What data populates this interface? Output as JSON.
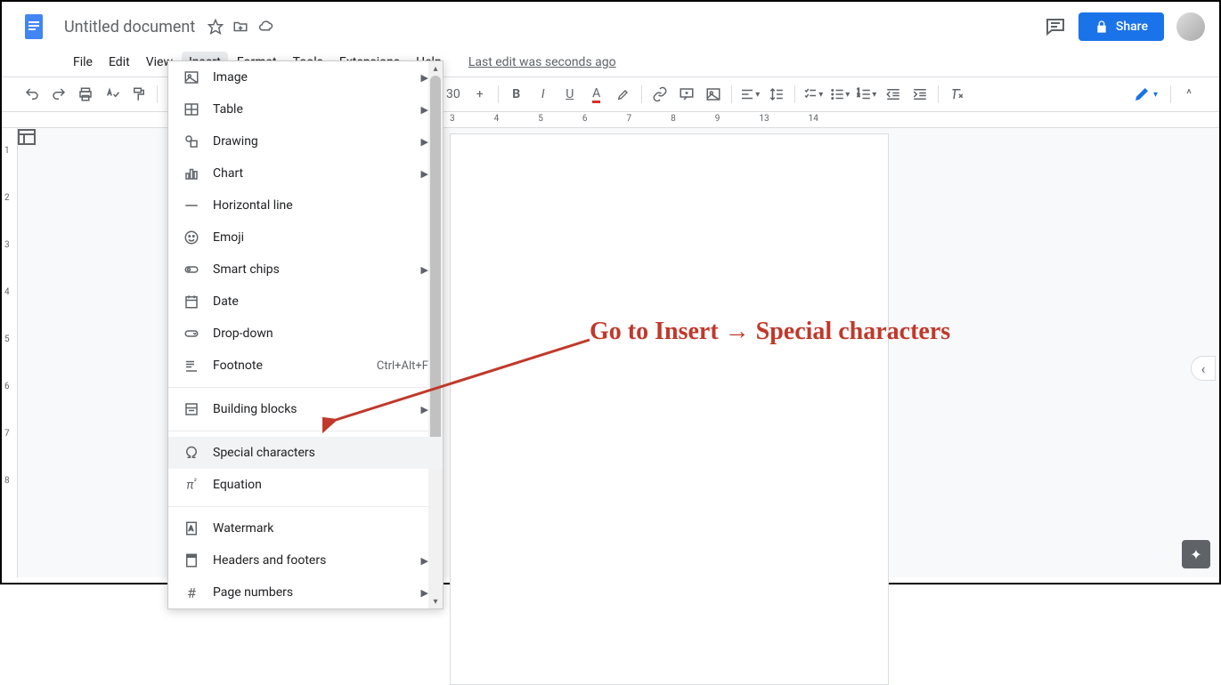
{
  "header": {
    "doc_title": "Untitled document",
    "share_label": "Share",
    "last_edit": "Last edit was seconds ago"
  },
  "menubar": {
    "items": [
      "File",
      "Edit",
      "View",
      "Insert",
      "Format",
      "Tools",
      "Extensions",
      "Help"
    ],
    "active_index": 3
  },
  "toolbar": {
    "zoom_visible": "30",
    "ruler_numbers": [
      "3",
      "4",
      "5",
      "6",
      "7",
      "8",
      "9",
      "13",
      "14"
    ],
    "ruler_v": [
      "1",
      "2",
      "3",
      "4",
      "5",
      "6",
      "7",
      "8"
    ]
  },
  "dropdown": {
    "groups": [
      [
        {
          "icon": "image",
          "label": "Image",
          "submenu": true
        },
        {
          "icon": "table",
          "label": "Table",
          "submenu": true
        },
        {
          "icon": "drawing",
          "label": "Drawing",
          "submenu": true
        },
        {
          "icon": "chart",
          "label": "Chart",
          "submenu": true
        },
        {
          "icon": "hr",
          "label": "Horizontal line"
        },
        {
          "icon": "emoji",
          "label": "Emoji"
        },
        {
          "icon": "chip",
          "label": "Smart chips",
          "submenu": true
        },
        {
          "icon": "date",
          "label": "Date"
        },
        {
          "icon": "dropdown",
          "label": "Drop-down"
        },
        {
          "icon": "footnote",
          "label": "Footnote",
          "shortcut": "Ctrl+Alt+F"
        }
      ],
      [
        {
          "icon": "blocks",
          "label": "Building blocks",
          "submenu": true
        }
      ],
      [
        {
          "icon": "omega",
          "label": "Special characters",
          "highlighted": true
        },
        {
          "icon": "equation",
          "label": "Equation"
        }
      ],
      [
        {
          "icon": "watermark",
          "label": "Watermark"
        },
        {
          "icon": "header",
          "label": "Headers and footers",
          "submenu": true
        },
        {
          "icon": "pagenum",
          "label": "Page numbers",
          "submenu": true
        }
      ]
    ]
  },
  "annotation": {
    "text": "Go to Insert → Special characters"
  }
}
